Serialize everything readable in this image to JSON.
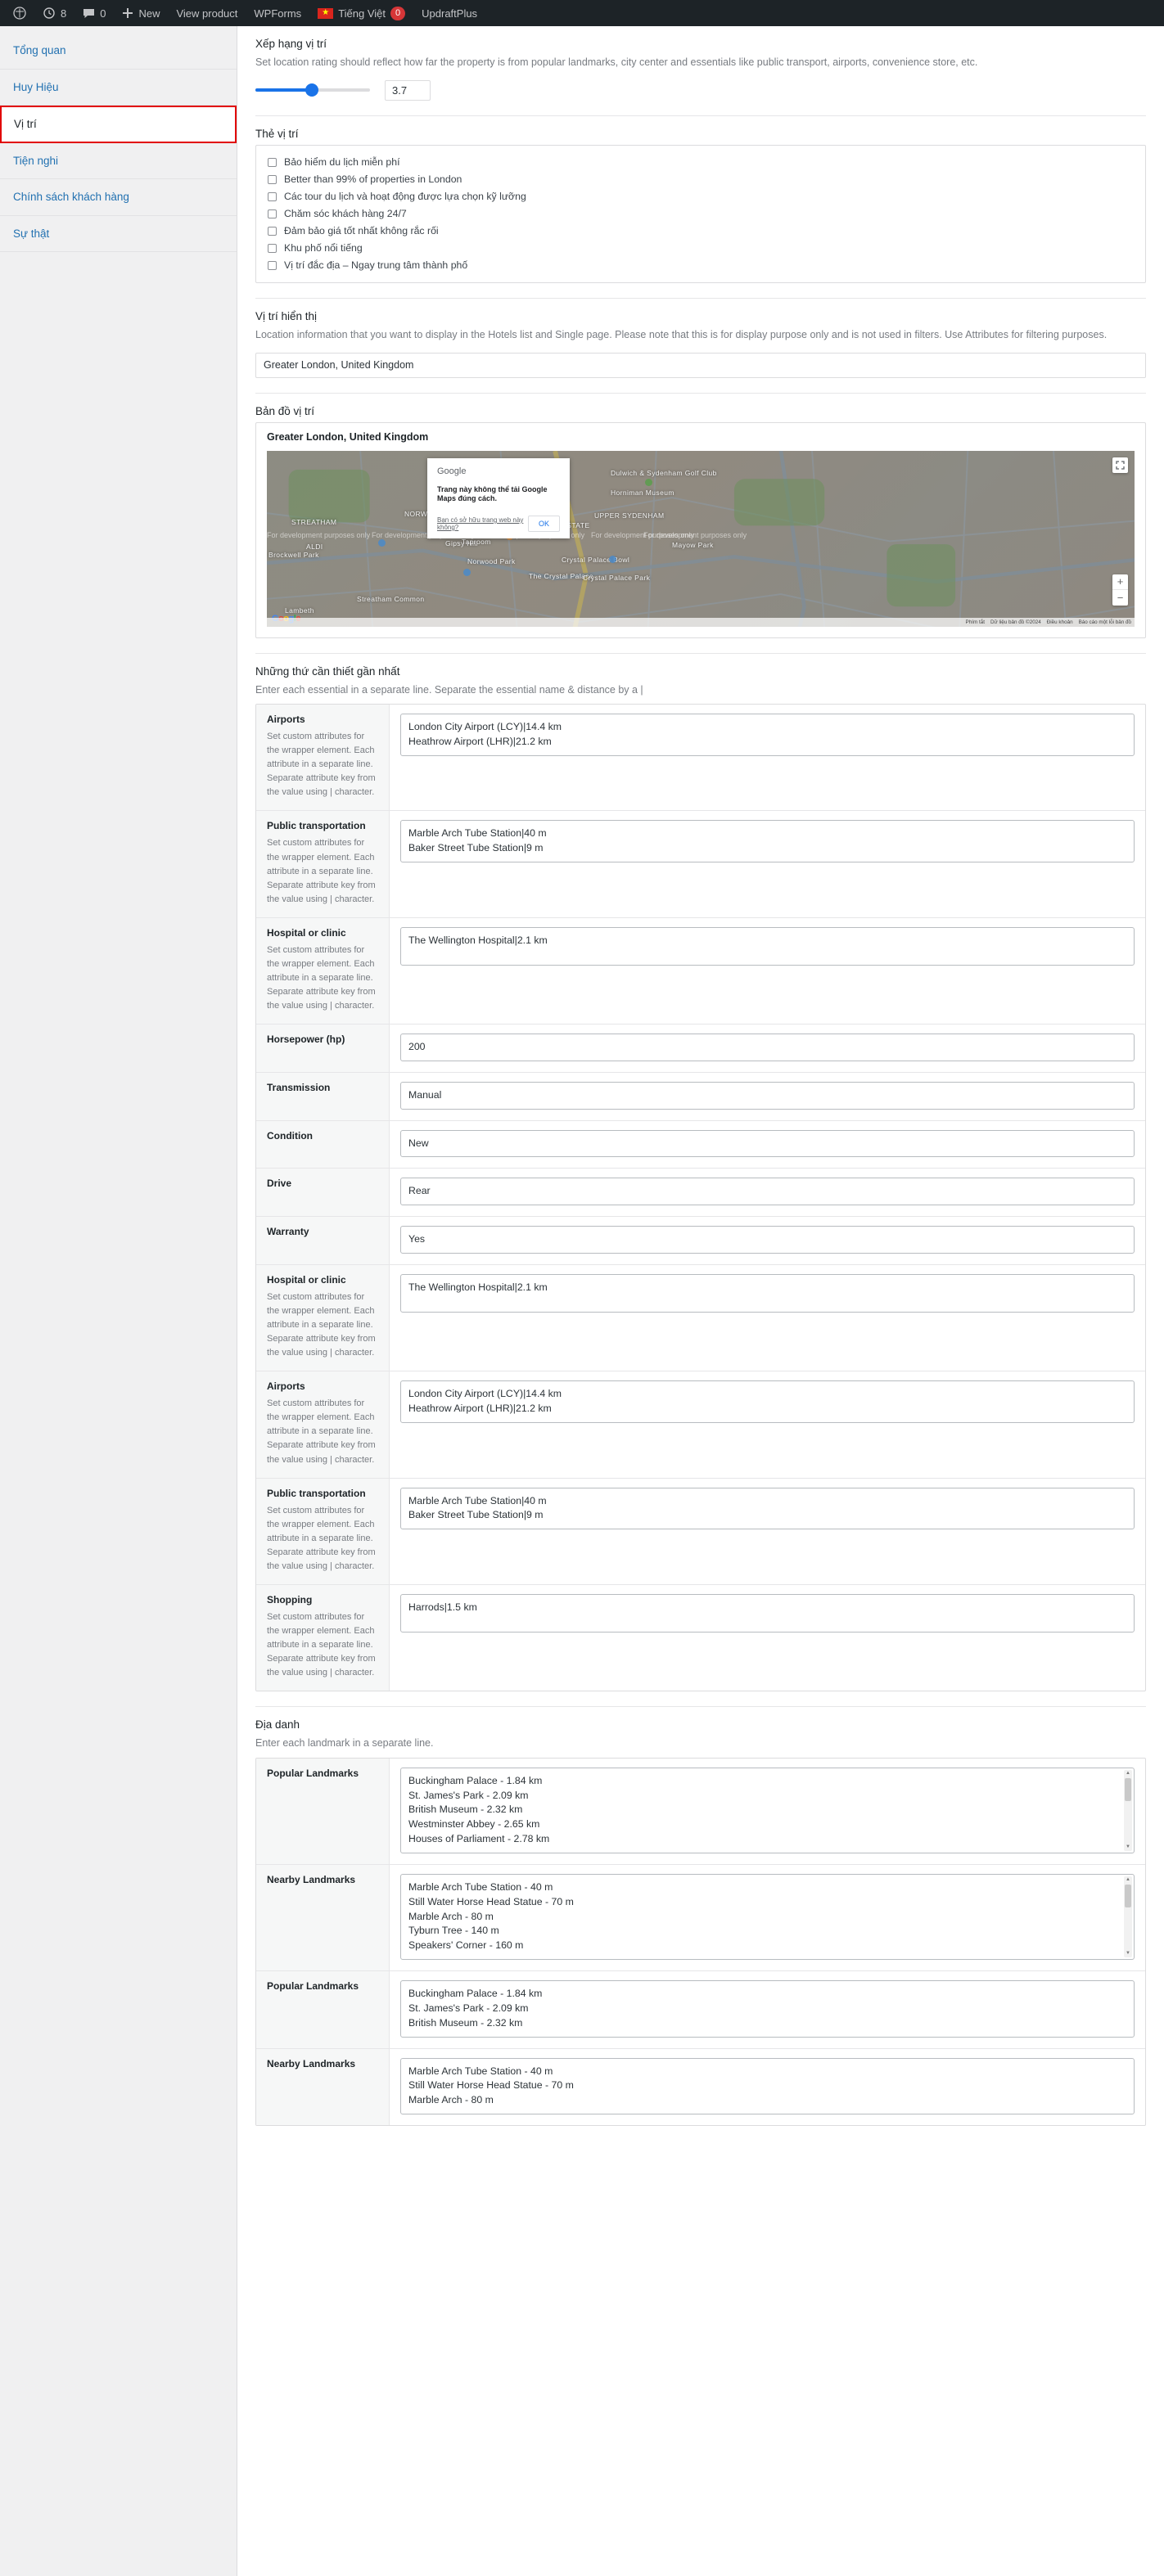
{
  "adminbar": {
    "items": [
      {
        "icon": "wordpress-icon",
        "label": ""
      },
      {
        "icon": "revisions-icon",
        "label": "8"
      },
      {
        "icon": "comment-icon",
        "label": "0"
      },
      {
        "icon": "plus-icon",
        "label": "New"
      },
      {
        "icon": "",
        "label": "View product"
      },
      {
        "icon": "",
        "label": "WPForms"
      },
      {
        "icon": "flag-vn-icon",
        "label": "Tiếng Việt",
        "badge": "0"
      },
      {
        "icon": "",
        "label": "UpdraftPlus"
      }
    ]
  },
  "sidebar": {
    "items": [
      {
        "label": "Tổng quan",
        "active": false
      },
      {
        "label": "Huy Hiệu",
        "active": false
      },
      {
        "label": "Vị trí",
        "active": true
      },
      {
        "label": "Tiện nghi",
        "active": false
      },
      {
        "label": "Chính sách khách hàng",
        "active": false
      },
      {
        "label": "Sự thật",
        "active": false
      }
    ]
  },
  "rating": {
    "title": "Xếp hạng vị trí",
    "description": "Set location rating should reflect how far the property is from popular landmarks, city center and essentials like public transport, airports, convenience store, etc.",
    "value": "3.7",
    "min": 0,
    "max": 5
  },
  "tags": {
    "title": "Thẻ vị trí",
    "options": [
      {
        "label": "Bảo hiểm du lịch miễn phí",
        "checked": false
      },
      {
        "label": "Better than 99% of properties in London",
        "checked": false
      },
      {
        "label": "Các tour du lịch và hoạt động được lựa chọn kỹ lưỡng",
        "checked": false
      },
      {
        "label": "Chăm sóc khách hàng 24/7",
        "checked": false
      },
      {
        "label": "Đảm bảo giá tốt nhất không rắc rối",
        "checked": false
      },
      {
        "label": "Khu phố nổi tiếng",
        "checked": false
      },
      {
        "label": "Vị trí đắc địa – Ngay trung tâm thành phố",
        "checked": false
      }
    ]
  },
  "display_location": {
    "title": "Vị trí hiển thị",
    "description": "Location information that you want to display in the Hotels list and Single page. Please note that this is for display purpose only and is not used in filters. Use Attributes for filtering purposes.",
    "value": "Greater London, United Kingdom"
  },
  "map": {
    "title": "Bản đồ vị trí",
    "heading": "Greater London, United Kingdom",
    "dialog": {
      "brand": "Google",
      "message": "Trang này không thể tải Google Maps đúng cách.",
      "link": "Bạn có sở hữu trang web này không?",
      "ok": "OK"
    },
    "labels": [
      "STREATHAM",
      "NORWOOD",
      "Gipsy Hill",
      "KINGSWOOD ESTATE",
      "UPPER SYDENHAM",
      "Dulwich & Sydenham Golf Club",
      "Horniman Museum",
      "Norwood Park",
      "Crystal Palace Bowl",
      "The Crystal Palace",
      "Crystal Palace Park",
      "Streatham Common",
      "Brockwell Park",
      "Gipsy Hill Brewing Company - Taproom",
      "Mayow Park",
      "ALDI",
      "Lambeth"
    ],
    "watermark": "For development purposes only",
    "logo": "Google",
    "footer": [
      "Phím tắt",
      "Dữ liệu bản đồ ©2024",
      "Điều khoản",
      "Báo cáo một lỗi bản đồ"
    ]
  },
  "essentials": {
    "title": "Những thứ cần thiết gần nhất",
    "description": "Enter each essential in a separate line. Separate the essential name & distance by a |",
    "help_text": "Set custom attributes for the wrapper element. Each attribute in a separate line. Separate attribute key from the value using | character.",
    "rows": [
      {
        "name": "Airports",
        "help": true,
        "value": "London City Airport (LCY)|14.4 km\nHeathrow Airport (LHR)|21.2 km",
        "size": "h2"
      },
      {
        "name": "Public transportation",
        "help": true,
        "value": "Marble Arch Tube Station|40 m\nBaker Street Tube Station|9 m",
        "size": "h2"
      },
      {
        "name": "Hospital or clinic",
        "help": true,
        "value": "The Wellington Hospital|2.1 km",
        "size": "h2"
      },
      {
        "name": "Horsepower (hp)",
        "help": false,
        "value": "200",
        "size": "h1"
      },
      {
        "name": "Transmission",
        "help": false,
        "value": "Manual",
        "size": "h1"
      },
      {
        "name": "Condition",
        "help": false,
        "value": "New",
        "size": "h1"
      },
      {
        "name": "Drive",
        "help": false,
        "value": "Rear",
        "size": "h1"
      },
      {
        "name": "Warranty",
        "help": false,
        "value": "Yes",
        "size": "h1"
      },
      {
        "name": "Hospital or clinic",
        "help": true,
        "value": "The Wellington Hospital|2.1 km",
        "size": "h2"
      },
      {
        "name": "Airports",
        "help": true,
        "value": "London City Airport (LCY)|14.4 km\nHeathrow Airport (LHR)|21.2 km",
        "size": "h2"
      },
      {
        "name": "Public transportation",
        "help": true,
        "value": "Marble Arch Tube Station|40 m\nBaker Street Tube Station|9 m",
        "size": "h2"
      },
      {
        "name": "Shopping",
        "help": true,
        "value": "Harrods|1.5 km",
        "size": "h2"
      }
    ]
  },
  "landmarks": {
    "title": "Địa danh",
    "description": "Enter each landmark in a separate line.",
    "rows": [
      {
        "name": "Popular Landmarks",
        "value": "Buckingham Palace - 1.84 km\nSt. James's Park - 2.09 km\nBritish Museum - 2.32 km\nWestminster Abbey - 2.65 km\nHouses of Parliament - 2.78 km",
        "scroll": true
      },
      {
        "name": "Nearby Landmarks",
        "value": "Marble Arch Tube Station - 40 m\nStill Water Horse Head Statue - 70 m\nMarble Arch - 80 m\nTyburn Tree - 140 m\nSpeakers' Corner - 160 m",
        "scroll": true
      },
      {
        "name": "Popular Landmarks",
        "value": "Buckingham Palace - 1.84 km\nSt. James's Park - 2.09 km\nBritish Museum - 2.32 km",
        "scroll": false
      },
      {
        "name": "Nearby Landmarks",
        "value": "Marble Arch Tube Station - 40 m\nStill Water Horse Head Statue - 70 m\nMarble Arch - 80 m",
        "scroll": false
      }
    ]
  }
}
